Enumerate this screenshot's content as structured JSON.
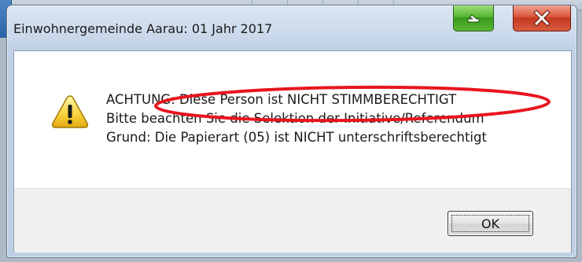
{
  "window": {
    "title": "Einwohnergemeinde Aarau: 01 Jahr 2017",
    "minimize_icon": "minimize-icon",
    "close_icon": "close-x-icon"
  },
  "message": {
    "icon": "warning-triangle-icon",
    "line1": "ACHTUNG: Diese Person ist NICHT STIMMBERECHTIGT",
    "line2": "Bitte beachten Sie die Selektion der Initiative/Referendum",
    "line3": "Grund: Die Papierart (05) ist NICHT unterschriftsberechtigt",
    "annotation_color": "#e8141e"
  },
  "buttons": {
    "ok_label": "OK"
  },
  "colors": {
    "close_button": "#c94a2f",
    "minimize_button": "#4aa728"
  }
}
